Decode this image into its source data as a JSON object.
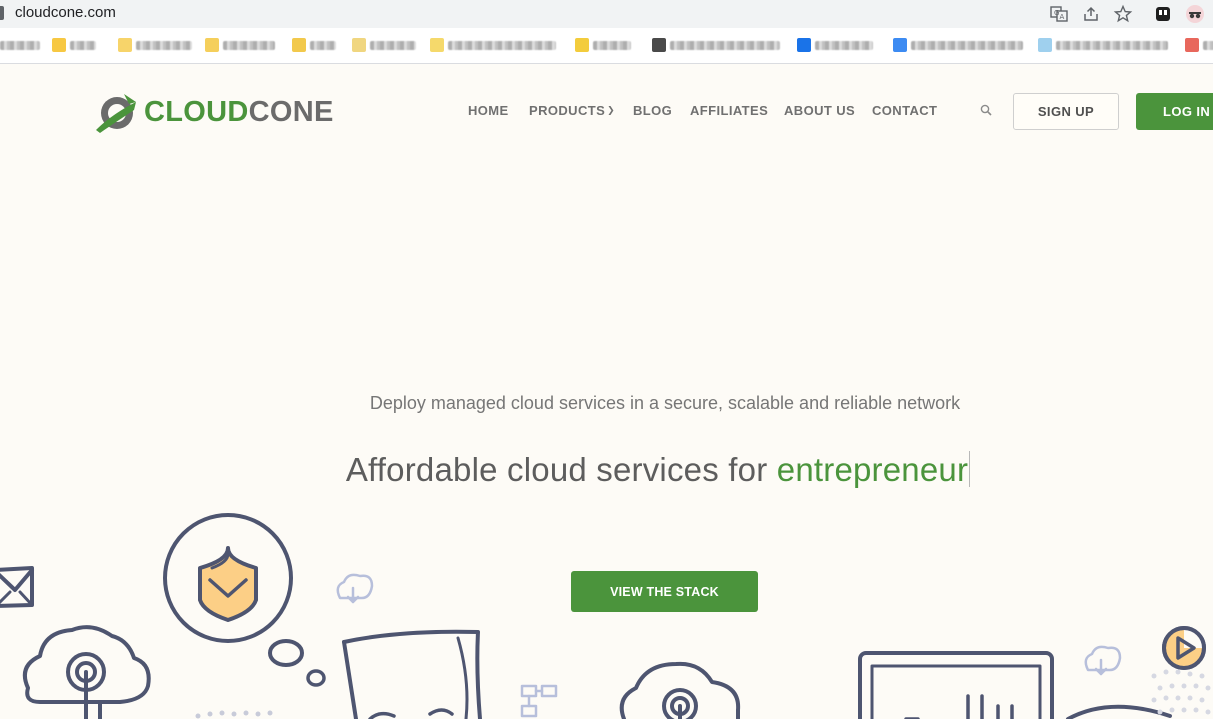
{
  "browser": {
    "url": "cloudcone.com"
  },
  "logo": {
    "part1": "CLOUD",
    "part2": "CONE"
  },
  "nav": {
    "items": [
      "HOME",
      "PRODUCTS",
      "BLOG",
      "AFFILIATES",
      "ABOUT US",
      "CONTACT"
    ],
    "signup": "SIGN UP",
    "login": "LOG IN"
  },
  "hero": {
    "subtitle": "Deploy managed cloud services in a secure, scalable and reliable network",
    "headline": "Affordable cloud services for ",
    "headline_accent": "entrepreneur",
    "cta": "VIEW THE STACK"
  },
  "colors": {
    "brand_green": "#4b943c",
    "text_gray": "#707070",
    "background": "#fdfbf6",
    "line_art": "#4e5570",
    "highlight_orange": "#fccf86"
  }
}
